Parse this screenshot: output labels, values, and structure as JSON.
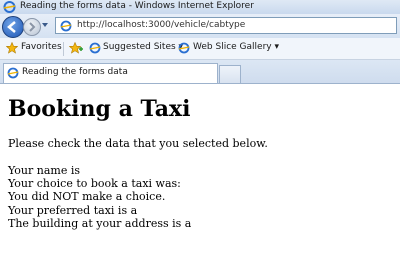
{
  "window": {
    "title": "Reading the forms data - Windows Internet Explorer"
  },
  "nav": {
    "url": "http://localhost:3000/vehicle/cabtype"
  },
  "favorites_bar": {
    "favorites_label": "Favorites",
    "suggested_sites_label": "Suggested Sites ▾",
    "web_slice_gallery_label": "Web Slice Gallery ▾"
  },
  "tab": {
    "title": "Reading the forms data"
  },
  "page": {
    "heading": "Booking a Taxi",
    "intro": "Please check the data that you selected below.",
    "lines": [
      "Your name is",
      "Your choice to book a taxi was:",
      "You did NOT make a choice.",
      "Your preferred taxi is a",
      "The building at your address is a"
    ]
  }
}
